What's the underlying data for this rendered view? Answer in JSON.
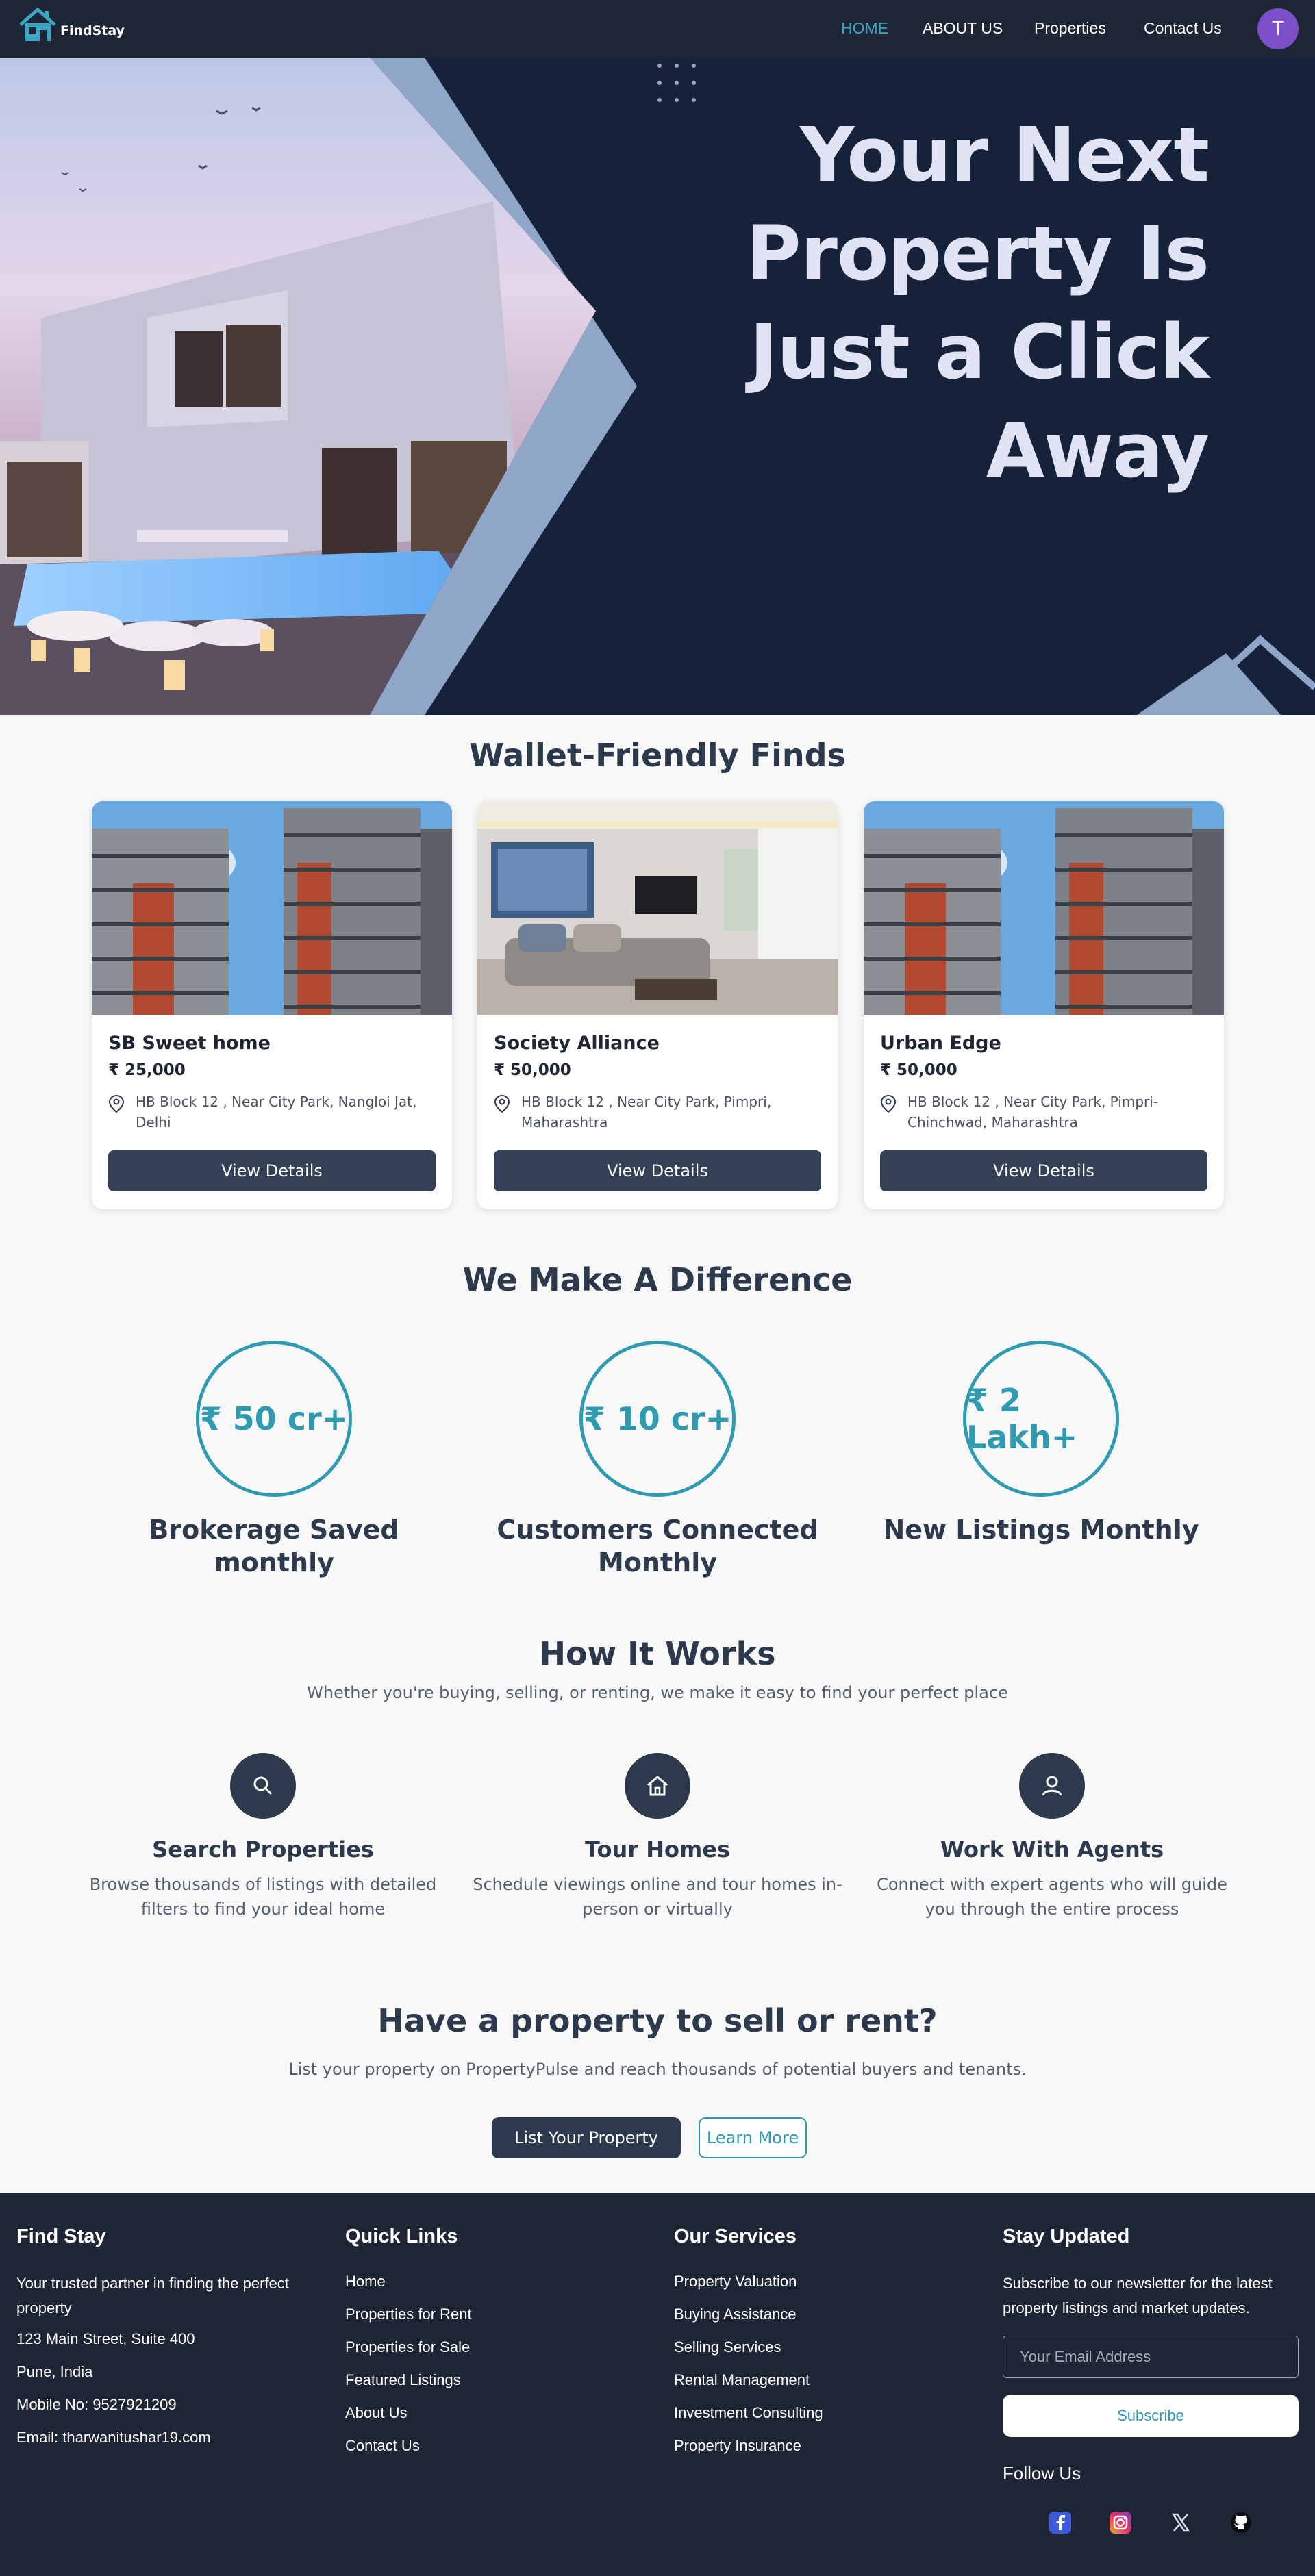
{
  "nav": {
    "logo_text": "FindStay",
    "links": [
      "HOME",
      "ABOUT US",
      "Properties",
      "Contact Us"
    ],
    "avatar_letter": "T"
  },
  "hero": {
    "title": "Your Next Property Is Just a Click Away"
  },
  "listings": {
    "title": "Wallet-Friendly Finds",
    "cards": [
      {
        "name": "SB Sweet home",
        "price": "₹ 25,000",
        "address": "HB Block 12 , Near City Park, Nangloi Jat, Delhi",
        "button": "View Details",
        "image": "tower-building"
      },
      {
        "name": "Society Alliance",
        "price": "₹ 50,000",
        "address": "HB Block 12 , Near City Park, Pimpri, Maharashtra",
        "button": "View Details",
        "image": "living-room"
      },
      {
        "name": "Urban Edge",
        "price": "₹ 50,000",
        "address": "HB Block 12 , Near City Park, Pimpri-Chinchwad, Maharashtra",
        "button": "View Details",
        "image": "tower-building"
      }
    ]
  },
  "stats": {
    "title": "We Make A Difference",
    "items": [
      {
        "value": "₹ 50 cr+",
        "label": "Brokerage Saved monthly"
      },
      {
        "value": "₹ 10 cr+",
        "label": "Customers Connected Monthly"
      },
      {
        "value": "₹ 2 Lakh+",
        "label": "New Listings Monthly"
      }
    ]
  },
  "how": {
    "title": "How It Works",
    "subtitle": "Whether you're buying, selling, or renting, we make it easy to find your perfect place",
    "steps": [
      {
        "icon": "search-icon",
        "title": "Search Properties",
        "desc": "Browse thousands of listings with detailed filters to find your ideal home"
      },
      {
        "icon": "home-icon",
        "title": "Tour Homes",
        "desc": "Schedule viewings online and tour homes in-person or virtually"
      },
      {
        "icon": "user-icon",
        "title": "Work With Agents",
        "desc": "Connect with expert agents who will guide you through the entire process"
      }
    ]
  },
  "cta": {
    "title": "Have a property to sell or rent?",
    "subtitle": "List your property on PropertyPulse and reach thousands of potential buyers and tenants.",
    "primary": "List Your Property",
    "secondary": "Learn More"
  },
  "footer": {
    "about": {
      "title": "Find Stay",
      "tagline": "Your trusted partner in finding the perfect property",
      "address1": "123 Main Street, Suite 400",
      "address2": "Pune, India",
      "mobile": "Mobile No: 9527921209",
      "email": "Email: tharwanitushar19.com"
    },
    "quick_links": {
      "title": "Quick Links",
      "items": [
        "Home",
        "Properties for Rent",
        "Properties for Sale",
        "Featured Listings",
        "About Us",
        "Contact Us"
      ]
    },
    "services": {
      "title": "Our Services",
      "items": [
        "Property Valuation",
        "Buying Assistance",
        "Selling Services",
        "Rental Management",
        "Investment Consulting",
        "Property Insurance"
      ]
    },
    "newsletter": {
      "title": "Stay Updated",
      "text": "Subscribe to our newsletter for the latest property listings and market updates.",
      "placeholder": "Your Email Address",
      "button": "Subscribe",
      "follow": "Follow Us",
      "socials": [
        "facebook-icon",
        "instagram-icon",
        "x-icon",
        "github-icon"
      ]
    }
  },
  "colors": {
    "nav_bg": "#1e2635",
    "accent": "#3aa6c4",
    "teal": "#2f9bb0",
    "button_dark": "#334055",
    "hero_bg": "#16213a",
    "hero_shape": "#8fa6c8"
  }
}
